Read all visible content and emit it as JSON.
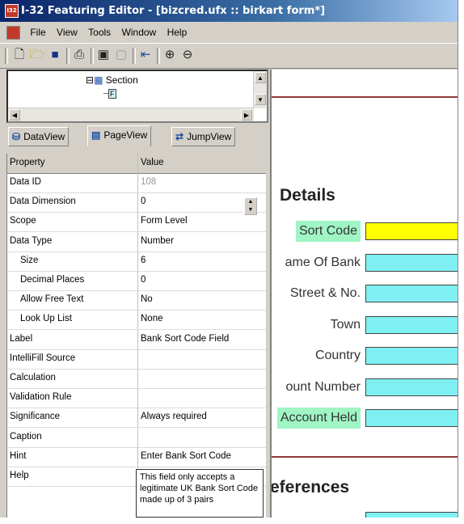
{
  "window": {
    "app_icon_text": "I32",
    "title": "I-32 Featuring Editor - [bizcred.ufx :: birkart form*]"
  },
  "menu": [
    "File",
    "View",
    "Tools",
    "Window",
    "Help"
  ],
  "toolbar": {
    "icons": [
      "new-icon",
      "open-icon",
      "save-icon",
      "print-icon",
      "copy-page-icon",
      "paste-page-icon",
      "import-icon",
      "zoom-in-icon",
      "zoom-out-icon"
    ]
  },
  "tree": {
    "section_label": "Section",
    "field_label": "F"
  },
  "tabs": [
    {
      "label": "DataView",
      "icon": "database-icon"
    },
    {
      "label": "PageView",
      "icon": "page-icon"
    },
    {
      "label": "JumpView",
      "icon": "jump-icon"
    }
  ],
  "properties": {
    "header": {
      "property": "Property",
      "value": "Value"
    },
    "rows": [
      {
        "name": "Data ID",
        "value": "108",
        "indent": false
      },
      {
        "name": "Data Dimension",
        "value": "0",
        "indent": false
      },
      {
        "name": "Scope",
        "value": "Form Level",
        "indent": false
      },
      {
        "name": "Data Type",
        "value": "Number",
        "indent": false
      },
      {
        "name": "Size",
        "value": "6",
        "indent": true
      },
      {
        "name": "Decimal Places",
        "value": "0",
        "indent": true
      },
      {
        "name": "Allow Free Text",
        "value": "No",
        "indent": true
      },
      {
        "name": "Look Up List",
        "value": "None",
        "indent": true
      },
      {
        "name": "Label",
        "value": "Bank Sort Code Field",
        "indent": false
      },
      {
        "name": "IntelliFill Source",
        "value": "",
        "indent": false
      },
      {
        "name": "Calculation",
        "value": "",
        "indent": false
      },
      {
        "name": "Validation Rule",
        "value": "",
        "indent": false
      },
      {
        "name": "Significance",
        "value": "Always required",
        "indent": false
      },
      {
        "name": "Caption",
        "value": "",
        "indent": false
      },
      {
        "name": "Hint",
        "value": "Enter Bank Sort Code",
        "indent": false
      },
      {
        "name": "Help",
        "value": "",
        "indent": false
      }
    ],
    "help_text": "This field only accepts a legitimate UK Bank Sort Code made up of 3 pairs"
  },
  "form": {
    "details_title": "Details",
    "fields": [
      {
        "label": "Sort Code",
        "highlight": true,
        "selected": true
      },
      {
        "label": "ame Of Bank",
        "highlight": false,
        "selected": false
      },
      {
        "label": "Street & No.",
        "highlight": false,
        "selected": false
      },
      {
        "label": "Town",
        "highlight": false,
        "selected": false
      },
      {
        "label": "Country",
        "highlight": false,
        "selected": false
      },
      {
        "label": "ount Number",
        "highlight": false,
        "selected": false
      },
      {
        "label": "Account Held",
        "highlight": true,
        "selected": false
      }
    ],
    "preferences_title": "eferences",
    "colors": {
      "label_highlight": "#9ff5c4",
      "input": "#7ff0f2",
      "input_selected": "#ffff00",
      "rule": "#8b3a3a"
    }
  }
}
